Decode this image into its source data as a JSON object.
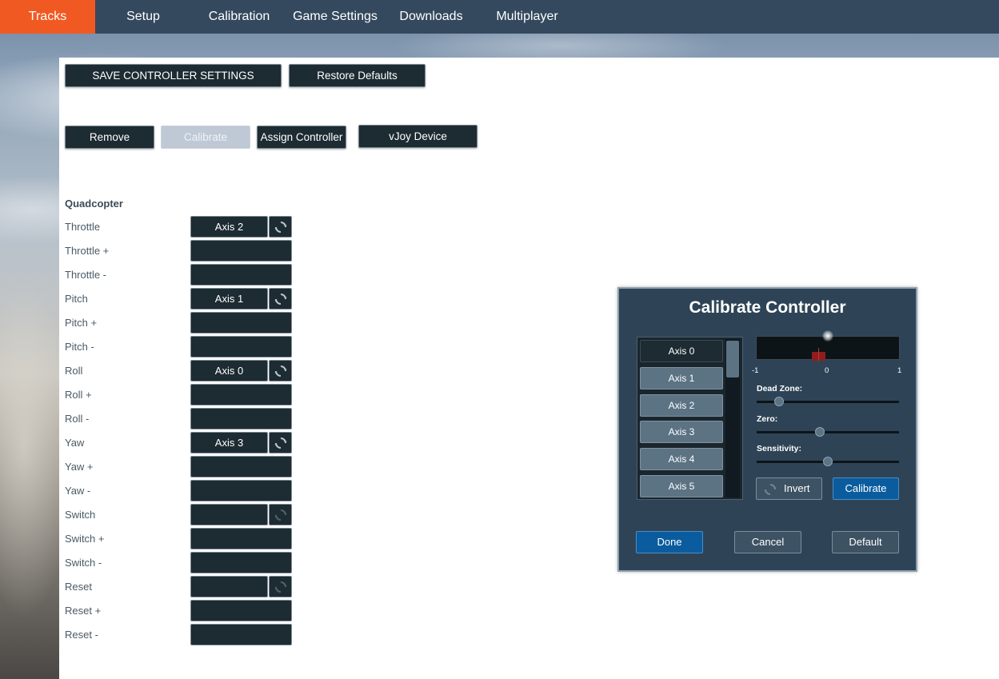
{
  "nav": {
    "items": [
      "Tracks",
      "Setup",
      "Calibration",
      "Game Settings",
      "Downloads",
      "Multiplayer"
    ],
    "active": "Tracks"
  },
  "toolbar": {
    "save_label": "SAVE CONTROLLER SETTINGS",
    "restore_label": "Restore Defaults",
    "remove_label": "Remove",
    "calibrate_label": "Calibrate",
    "assign_label": "Assign Controller",
    "vjoy_label": "vJoy Device"
  },
  "section": {
    "title": "Quadcopter"
  },
  "mappings": [
    {
      "label": "Throttle",
      "axis": "Axis 2",
      "has_invert": true
    },
    {
      "label": "Throttle +",
      "axis": null,
      "has_invert": false
    },
    {
      "label": "Throttle -",
      "axis": null,
      "has_invert": false
    },
    {
      "label": "Pitch",
      "axis": "Axis 1",
      "has_invert": true
    },
    {
      "label": "Pitch +",
      "axis": null,
      "has_invert": false
    },
    {
      "label": "Pitch -",
      "axis": null,
      "has_invert": false
    },
    {
      "label": "Roll",
      "axis": "Axis 0",
      "has_invert": true
    },
    {
      "label": "Roll +",
      "axis": null,
      "has_invert": false
    },
    {
      "label": "Roll -",
      "axis": null,
      "has_invert": false
    },
    {
      "label": "Yaw",
      "axis": "Axis 3",
      "has_invert": true
    },
    {
      "label": "Yaw +",
      "axis": null,
      "has_invert": false
    },
    {
      "label": "Yaw -",
      "axis": null,
      "has_invert": false
    },
    {
      "label": "Switch",
      "axis": "",
      "has_invert": true
    },
    {
      "label": "Switch +",
      "axis": null,
      "has_invert": false
    },
    {
      "label": "Switch -",
      "axis": null,
      "has_invert": false
    },
    {
      "label": "Reset",
      "axis": "",
      "has_invert": true
    },
    {
      "label": "Reset +",
      "axis": null,
      "has_invert": false
    },
    {
      "label": "Reset -",
      "axis": null,
      "has_invert": false
    }
  ],
  "dialog": {
    "title": "Calibrate Controller",
    "axes": [
      "Axis 0",
      "Axis 1",
      "Axis 2",
      "Axis 3",
      "Axis 4",
      "Axis 5"
    ],
    "selected_axis": "Axis 0",
    "ticks": {
      "min": "-1",
      "mid": "0",
      "max": "1"
    },
    "dead_zone_label": "Dead Zone:",
    "zero_label": "Zero:",
    "sensitivity_label": "Sensitivity:",
    "dead_zone_value": 0.13,
    "zero_value": 0.44,
    "sensitivity_value": 0.5,
    "invert_label": "Invert",
    "calibrate_label": "Calibrate",
    "done_label": "Done",
    "cancel_label": "Cancel",
    "default_label": "Default"
  },
  "colors": {
    "nav_bg": "#34495e",
    "nav_active": "#f05a22",
    "button_dark": "#1d2b32",
    "dialog_bg": "#2e4456",
    "accent_blue": "#0a5c9e"
  }
}
